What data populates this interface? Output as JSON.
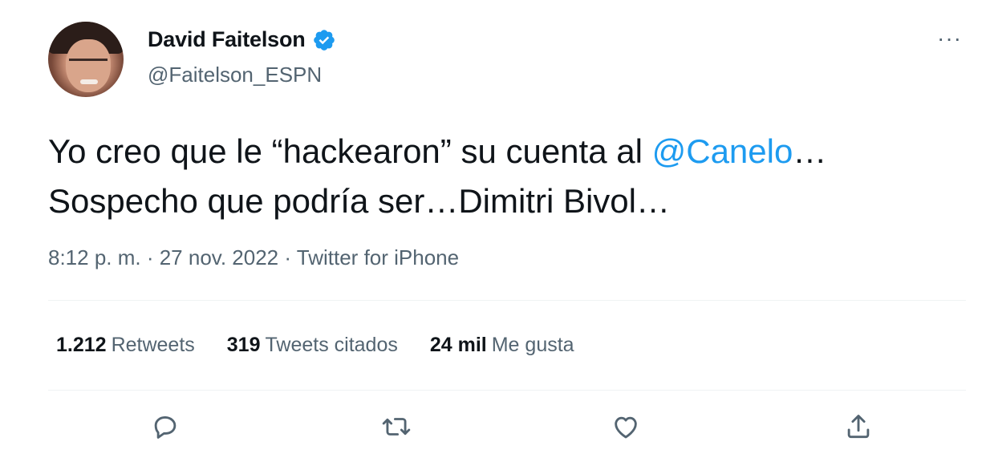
{
  "author": {
    "name": "David Faitelson",
    "handle": "@Faitelson_ESPN",
    "verified": true
  },
  "tweet": {
    "text_part1": "Yo creo que le “hackearon” su cuenta al ",
    "mention": "@Canelo",
    "text_part2": "…",
    "text_line2": "Sospecho que podría ser…Dimitri Bivol…",
    "timestamp": "8:12 p. m. · 27 nov. 2022 · Twitter for iPhone"
  },
  "stats": {
    "retweets_count": "1.212",
    "retweets_label": "Retweets",
    "quotes_count": "319",
    "quotes_label": "Tweets citados",
    "likes_count": "24 mil",
    "likes_label": "Me gusta"
  },
  "more_label": "···",
  "icons": {
    "reply": "reply-icon",
    "retweet": "retweet-icon",
    "like": "like-icon",
    "share": "share-icon",
    "verified": "verified-icon"
  },
  "colors": {
    "accent": "#1d9bf0",
    "text": "#0f1419",
    "secondary": "#536471",
    "divider": "#eff3f4"
  }
}
